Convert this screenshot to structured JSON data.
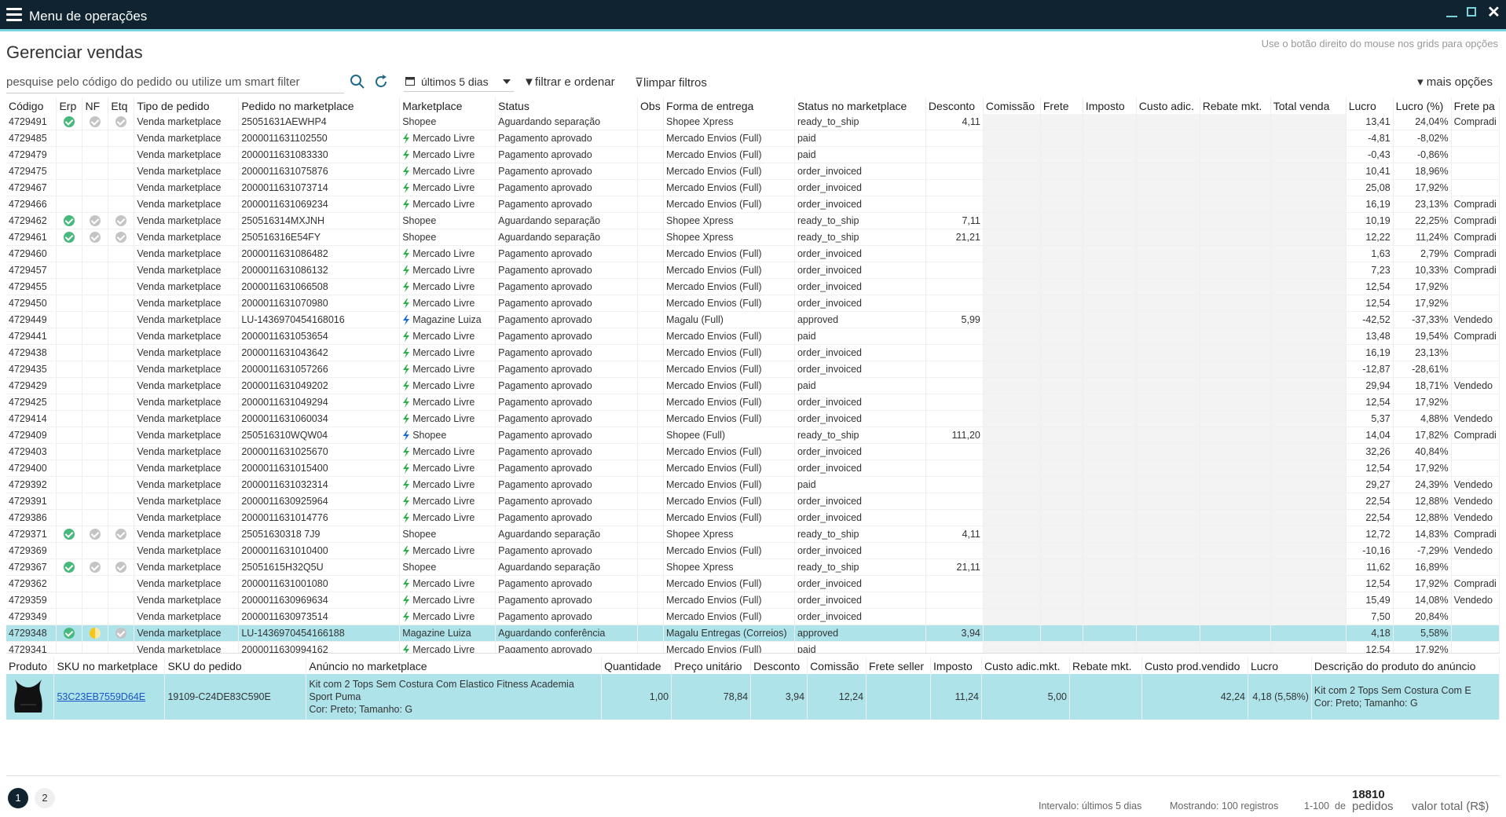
{
  "app": {
    "title": "Menu de operações"
  },
  "page": {
    "title": "Gerenciar vendas",
    "hint": "Use o botão direito do mouse nos grids para opções"
  },
  "toolbar": {
    "search_placeholder": "pesquise pelo código do pedido ou utilize um smart filter",
    "date_range": "últimos 5 dias",
    "filter_label": "filtrar e ordenar",
    "clear_label": "limpar filtros",
    "more_label": "mais opções"
  },
  "colors": {
    "topbar": "#0f2430",
    "accent": "#7ad3df",
    "selected_row": "#aee3ea",
    "positive": "#3aa83a",
    "negative": "#e04040",
    "check_ok": "#47b97c"
  },
  "grid": {
    "columns": [
      "Código",
      "Erp",
      "NF",
      "Etq",
      "Tipo de pedido",
      "Pedido no marketplace",
      "Marketplace",
      "Status",
      "Obs",
      "Forma de entrega",
      "Status no marketplace",
      "Desconto",
      "Comissão",
      "Frete",
      "Imposto",
      "Custo adic.",
      "Rebate mkt.",
      "Total venda",
      "Lucro",
      "Lucro (%)",
      "Frete pa"
    ],
    "rows": [
      {
        "codigo": "4729491",
        "erp": "ok",
        "nf": "grey",
        "etq": "grey",
        "tipo": "Venda marketplace",
        "pedido": "25051631AEWHP4",
        "bolt": false,
        "mkt": "Shopee",
        "status": "Aguardando separação",
        "forma": "Shopee Xpress",
        "status_mkt": "ready_to_ship",
        "desconto": "4,11",
        "lucro": "13,41",
        "lucro_pct": "24,04%",
        "frete": "Compradi"
      },
      {
        "codigo": "4729485",
        "erp": "",
        "nf": "",
        "etq": "",
        "tipo": "Venda marketplace",
        "pedido": "2000011631102550",
        "bolt": true,
        "mkt": "Mercado Livre",
        "status": "Pagamento aprovado",
        "forma": "Mercado Envios (Full)",
        "status_mkt": "paid",
        "desconto": "",
        "lucro": "-4,81",
        "lucro_pct": "-8,02%",
        "frete": ""
      },
      {
        "codigo": "4729479",
        "erp": "",
        "nf": "",
        "etq": "",
        "tipo": "Venda marketplace",
        "pedido": "2000011631083330",
        "bolt": true,
        "mkt": "Mercado Livre",
        "status": "Pagamento aprovado",
        "forma": "Mercado Envios (Full)",
        "status_mkt": "paid",
        "desconto": "",
        "lucro": "-0,43",
        "lucro_pct": "-0,86%",
        "frete": ""
      },
      {
        "codigo": "4729475",
        "erp": "",
        "nf": "",
        "etq": "",
        "tipo": "Venda marketplace",
        "pedido": "2000011631075876",
        "bolt": true,
        "mkt": "Mercado Livre",
        "status": "Pagamento aprovado",
        "forma": "Mercado Envios (Full)",
        "status_mkt": "order_invoiced",
        "desconto": "",
        "lucro": "10,41",
        "lucro_pct": "18,96%",
        "frete": ""
      },
      {
        "codigo": "4729467",
        "erp": "",
        "nf": "",
        "etq": "",
        "tipo": "Venda marketplace",
        "pedido": "2000011631073714",
        "bolt": true,
        "mkt": "Mercado Livre",
        "status": "Pagamento aprovado",
        "forma": "Mercado Envios (Full)",
        "status_mkt": "order_invoiced",
        "desconto": "",
        "lucro": "25,08",
        "lucro_pct": "17,92%",
        "frete": ""
      },
      {
        "codigo": "4729466",
        "erp": "",
        "nf": "",
        "etq": "",
        "tipo": "Venda marketplace",
        "pedido": "2000011631069234",
        "bolt": true,
        "mkt": "Mercado Livre",
        "status": "Pagamento aprovado",
        "forma": "Mercado Envios (Full)",
        "status_mkt": "order_invoiced",
        "desconto": "",
        "lucro": "16,19",
        "lucro_pct": "23,13%",
        "frete": "Compradi"
      },
      {
        "codigo": "4729462",
        "erp": "ok",
        "nf": "grey",
        "etq": "grey",
        "tipo": "Venda marketplace",
        "pedido": "250516314MXJNH",
        "bolt": false,
        "mkt": "Shopee",
        "status": "Aguardando separação",
        "forma": "Shopee Xpress",
        "status_mkt": "ready_to_ship",
        "desconto": "7,11",
        "lucro": "10,19",
        "lucro_pct": "22,25%",
        "frete": "Compradi"
      },
      {
        "codigo": "4729461",
        "erp": "ok",
        "nf": "grey",
        "etq": "grey",
        "tipo": "Venda marketplace",
        "pedido": "250516316E54FY",
        "bolt": false,
        "mkt": "Shopee",
        "status": "Aguardando separação",
        "forma": "Shopee Xpress",
        "status_mkt": "ready_to_ship",
        "desconto": "21,21",
        "lucro": "12,22",
        "lucro_pct": "11,24%",
        "frete": "Compradi"
      },
      {
        "codigo": "4729460",
        "erp": "",
        "nf": "",
        "etq": "",
        "tipo": "Venda marketplace",
        "pedido": "2000011631086482",
        "bolt": true,
        "mkt": "Mercado Livre",
        "status": "Pagamento aprovado",
        "forma": "Mercado Envios (Full)",
        "status_mkt": "order_invoiced",
        "desconto": "",
        "lucro": "1,63",
        "lucro_pct": "2,79%",
        "frete": "Compradi"
      },
      {
        "codigo": "4729457",
        "erp": "",
        "nf": "",
        "etq": "",
        "tipo": "Venda marketplace",
        "pedido": "2000011631086132",
        "bolt": true,
        "mkt": "Mercado Livre",
        "status": "Pagamento aprovado",
        "forma": "Mercado Envios (Full)",
        "status_mkt": "order_invoiced",
        "desconto": "",
        "lucro": "7,23",
        "lucro_pct": "10,33%",
        "frete": "Compradi"
      },
      {
        "codigo": "4729455",
        "erp": "",
        "nf": "",
        "etq": "",
        "tipo": "Venda marketplace",
        "pedido": "2000011631066508",
        "bolt": true,
        "mkt": "Mercado Livre",
        "status": "Pagamento aprovado",
        "forma": "Mercado Envios (Full)",
        "status_mkt": "order_invoiced",
        "desconto": "",
        "lucro": "12,54",
        "lucro_pct": "17,92%",
        "frete": ""
      },
      {
        "codigo": "4729450",
        "erp": "",
        "nf": "",
        "etq": "",
        "tipo": "Venda marketplace",
        "pedido": "2000011631070980",
        "bolt": true,
        "mkt": "Mercado Livre",
        "status": "Pagamento aprovado",
        "forma": "Mercado Envios (Full)",
        "status_mkt": "order_invoiced",
        "desconto": "",
        "lucro": "12,54",
        "lucro_pct": "17,92%",
        "frete": ""
      },
      {
        "codigo": "4729449",
        "erp": "",
        "nf": "",
        "etq": "",
        "tipo": "Venda marketplace",
        "pedido": "LU-1436970454168016",
        "bolt": true,
        "mkt": "Magazine Luiza",
        "status": "Pagamento aprovado",
        "forma": "Magalu (Full)",
        "status_mkt": "approved",
        "desconto": "5,99",
        "lucro": "-42,52",
        "lucro_pct": "-37,33%",
        "frete": "Vendedo"
      },
      {
        "codigo": "4729441",
        "erp": "",
        "nf": "",
        "etq": "",
        "tipo": "Venda marketplace",
        "pedido": "2000011631053654",
        "bolt": true,
        "mkt": "Mercado Livre",
        "status": "Pagamento aprovado",
        "forma": "Mercado Envios (Full)",
        "status_mkt": "paid",
        "desconto": "",
        "lucro": "13,48",
        "lucro_pct": "19,54%",
        "frete": "Compradi"
      },
      {
        "codigo": "4729438",
        "erp": "",
        "nf": "",
        "etq": "",
        "tipo": "Venda marketplace",
        "pedido": "2000011631043642",
        "bolt": true,
        "mkt": "Mercado Livre",
        "status": "Pagamento aprovado",
        "forma": "Mercado Envios (Full)",
        "status_mkt": "order_invoiced",
        "desconto": "",
        "lucro": "16,19",
        "lucro_pct": "23,13%",
        "frete": ""
      },
      {
        "codigo": "4729435",
        "erp": "",
        "nf": "",
        "etq": "",
        "tipo": "Venda marketplace",
        "pedido": "2000011631057266",
        "bolt": true,
        "mkt": "Mercado Livre",
        "status": "Pagamento aprovado",
        "forma": "Mercado Envios (Full)",
        "status_mkt": "order_invoiced",
        "desconto": "",
        "lucro": "-12,87",
        "lucro_pct": "-28,61%",
        "frete": ""
      },
      {
        "codigo": "4729429",
        "erp": "",
        "nf": "",
        "etq": "",
        "tipo": "Venda marketplace",
        "pedido": "2000011631049202",
        "bolt": true,
        "mkt": "Mercado Livre",
        "status": "Pagamento aprovado",
        "forma": "Mercado Envios (Full)",
        "status_mkt": "paid",
        "desconto": "",
        "lucro": "29,94",
        "lucro_pct": "18,71%",
        "frete": "Vendedo"
      },
      {
        "codigo": "4729425",
        "erp": "",
        "nf": "",
        "etq": "",
        "tipo": "Venda marketplace",
        "pedido": "2000011631049294",
        "bolt": true,
        "mkt": "Mercado Livre",
        "status": "Pagamento aprovado",
        "forma": "Mercado Envios (Full)",
        "status_mkt": "order_invoiced",
        "desconto": "",
        "lucro": "12,54",
        "lucro_pct": "17,92%",
        "frete": ""
      },
      {
        "codigo": "4729414",
        "erp": "",
        "nf": "",
        "etq": "",
        "tipo": "Venda marketplace",
        "pedido": "2000011631060034",
        "bolt": true,
        "mkt": "Mercado Livre",
        "status": "Pagamento aprovado",
        "forma": "Mercado Envios (Full)",
        "status_mkt": "order_invoiced",
        "desconto": "",
        "lucro": "5,37",
        "lucro_pct": "4,88%",
        "frete": "Vendedo"
      },
      {
        "codigo": "4729409",
        "erp": "",
        "nf": "",
        "etq": "",
        "tipo": "Venda marketplace",
        "pedido": "250516310WQW04",
        "bolt": true,
        "mkt": "Shopee",
        "status": "Pagamento aprovado",
        "forma": "Shopee (Full)",
        "status_mkt": "ready_to_ship",
        "desconto": "111,20",
        "lucro": "14,04",
        "lucro_pct": "17,82%",
        "frete": "Compradi"
      },
      {
        "codigo": "4729403",
        "erp": "",
        "nf": "",
        "etq": "",
        "tipo": "Venda marketplace",
        "pedido": "2000011631025670",
        "bolt": true,
        "mkt": "Mercado Livre",
        "status": "Pagamento aprovado",
        "forma": "Mercado Envios (Full)",
        "status_mkt": "order_invoiced",
        "desconto": "",
        "lucro": "32,26",
        "lucro_pct": "40,84%",
        "frete": ""
      },
      {
        "codigo": "4729400",
        "erp": "",
        "nf": "",
        "etq": "",
        "tipo": "Venda marketplace",
        "pedido": "2000011631015400",
        "bolt": true,
        "mkt": "Mercado Livre",
        "status": "Pagamento aprovado",
        "forma": "Mercado Envios (Full)",
        "status_mkt": "order_invoiced",
        "desconto": "",
        "lucro": "12,54",
        "lucro_pct": "17,92%",
        "frete": ""
      },
      {
        "codigo": "4729392",
        "erp": "",
        "nf": "",
        "etq": "",
        "tipo": "Venda marketplace",
        "pedido": "2000011631032314",
        "bolt": true,
        "mkt": "Mercado Livre",
        "status": "Pagamento aprovado",
        "forma": "Mercado Envios (Full)",
        "status_mkt": "paid",
        "desconto": "",
        "lucro": "29,27",
        "lucro_pct": "24,39%",
        "frete": "Vendedo"
      },
      {
        "codigo": "4729391",
        "erp": "",
        "nf": "",
        "etq": "",
        "tipo": "Venda marketplace",
        "pedido": "2000011630925964",
        "bolt": true,
        "mkt": "Mercado Livre",
        "status": "Pagamento aprovado",
        "forma": "Mercado Envios (Full)",
        "status_mkt": "order_invoiced",
        "desconto": "",
        "lucro": "22,54",
        "lucro_pct": "12,88%",
        "frete": "Vendedo"
      },
      {
        "codigo": "4729386",
        "erp": "",
        "nf": "",
        "etq": "",
        "tipo": "Venda marketplace",
        "pedido": "2000011631014776",
        "bolt": true,
        "mkt": "Mercado Livre",
        "status": "Pagamento aprovado",
        "forma": "Mercado Envios (Full)",
        "status_mkt": "order_invoiced",
        "desconto": "",
        "lucro": "22,54",
        "lucro_pct": "12,88%",
        "frete": "Vendedo"
      },
      {
        "codigo": "4729371",
        "erp": "ok",
        "nf": "grey",
        "etq": "grey",
        "tipo": "Venda marketplace",
        "pedido": "25051630318 7J9",
        "bolt": false,
        "mkt": "Shopee",
        "status": "Aguardando separação",
        "forma": "Shopee Xpress",
        "status_mkt": "ready_to_ship",
        "desconto": "4,11",
        "lucro": "12,72",
        "lucro_pct": "14,83%",
        "frete": "Compradi"
      },
      {
        "codigo": "4729369",
        "erp": "",
        "nf": "",
        "etq": "",
        "tipo": "Venda marketplace",
        "pedido": "2000011631010400",
        "bolt": true,
        "mkt": "Mercado Livre",
        "status": "Pagamento aprovado",
        "forma": "Mercado Envios (Full)",
        "status_mkt": "order_invoiced",
        "desconto": "",
        "lucro": "-10,16",
        "lucro_pct": "-7,29%",
        "frete": "Vendedo"
      },
      {
        "codigo": "4729367",
        "erp": "ok",
        "nf": "grey",
        "etq": "grey",
        "tipo": "Venda marketplace",
        "pedido": "25051615H32Q5U",
        "bolt": false,
        "mkt": "Shopee",
        "status": "Aguardando separação",
        "forma": "Shopee Xpress",
        "status_mkt": "ready_to_ship",
        "desconto": "21,11",
        "lucro": "11,62",
        "lucro_pct": "16,89%",
        "frete": ""
      },
      {
        "codigo": "4729362",
        "erp": "",
        "nf": "",
        "etq": "",
        "tipo": "Venda marketplace",
        "pedido": "2000011631001080",
        "bolt": true,
        "mkt": "Mercado Livre",
        "status": "Pagamento aprovado",
        "forma": "Mercado Envios (Full)",
        "status_mkt": "order_invoiced",
        "desconto": "",
        "lucro": "12,54",
        "lucro_pct": "17,92%",
        "frete": "Compradi"
      },
      {
        "codigo": "4729359",
        "erp": "",
        "nf": "",
        "etq": "",
        "tipo": "Venda marketplace",
        "pedido": "2000011630969634",
        "bolt": true,
        "mkt": "Mercado Livre",
        "status": "Pagamento aprovado",
        "forma": "Mercado Envios (Full)",
        "status_mkt": "order_invoiced",
        "desconto": "",
        "lucro": "15,49",
        "lucro_pct": "14,08%",
        "frete": "Vendedo"
      },
      {
        "codigo": "4729349",
        "erp": "",
        "nf": "",
        "etq": "",
        "tipo": "Venda marketplace",
        "pedido": "2000011630973514",
        "bolt": true,
        "mkt": "Mercado Livre",
        "status": "Pagamento aprovado",
        "forma": "Mercado Envios (Full)",
        "status_mkt": "order_invoiced",
        "desconto": "",
        "lucro": "7,50",
        "lucro_pct": "20,84%",
        "frete": ""
      },
      {
        "codigo": "4729348",
        "erp": "ok",
        "nf": "half",
        "etq": "grey",
        "tipo": "Venda marketplace",
        "pedido": "LU-1436970454166188",
        "bolt": false,
        "mkt": "Magazine Luiza",
        "status": "Aguardando conferência",
        "forma": "Magalu Entregas (Correios)",
        "status_mkt": "approved",
        "desconto": "3,94",
        "lucro": "4,18",
        "lucro_pct": "5,58%",
        "frete": "",
        "selected": true
      },
      {
        "codigo": "4729341",
        "erp": "",
        "nf": "",
        "etq": "",
        "tipo": "Venda marketplace",
        "pedido": "2000011630994162",
        "bolt": true,
        "mkt": "Mercado Livre",
        "status": "Pagamento aprovado",
        "forma": "Mercado Envios (Full)",
        "status_mkt": "paid",
        "desconto": "",
        "lucro": "12,54",
        "lucro_pct": "17,92%",
        "frete": ""
      }
    ]
  },
  "detail": {
    "columns": [
      "Produto",
      "SKU no marketplace",
      "SKU do pedido",
      "Anúncio no marketplace",
      "Quantidade",
      "Preço unitário",
      "Desconto",
      "Comissão",
      "Frete seller",
      "Imposto",
      "Custo adic.mkt.",
      "Rebate mkt.",
      "Custo prod.vendido",
      "Lucro",
      "Descrição do produto do anúncio"
    ],
    "row": {
      "sku_mkt": "53C23EB7559D64E",
      "sku_pedido": "19109-C24DE83C590E",
      "anuncio_line1": "Kit com 2 Tops Sem Costura Com Elastico Fitness Academia Sport Puma",
      "anuncio_line2": "Cor: Preto; Tamanho: G",
      "quantidade": "1,00",
      "preco": "78,84",
      "desconto": "3,94",
      "comissao": "12,24",
      "frete_seller": "",
      "imposto": "11,24",
      "custo_adic": "5,00",
      "rebate": "",
      "custo_prod": "42,24",
      "lucro": "4,18 (5,58%)",
      "descricao_line1": "Kit com 2 Tops Sem Costura Com E",
      "descricao_line2": "Cor: Preto; Tamanho: G"
    }
  },
  "footer": {
    "pages": [
      "1",
      "2"
    ],
    "intervalo": "Intervalo: últimos 5 dias",
    "mostrando": "Mostrando: 100 registros",
    "range": "1-100",
    "de": "de",
    "total_count": "18810",
    "total_label": "pedidos",
    "valor_total_label": "valor total (R$)"
  }
}
